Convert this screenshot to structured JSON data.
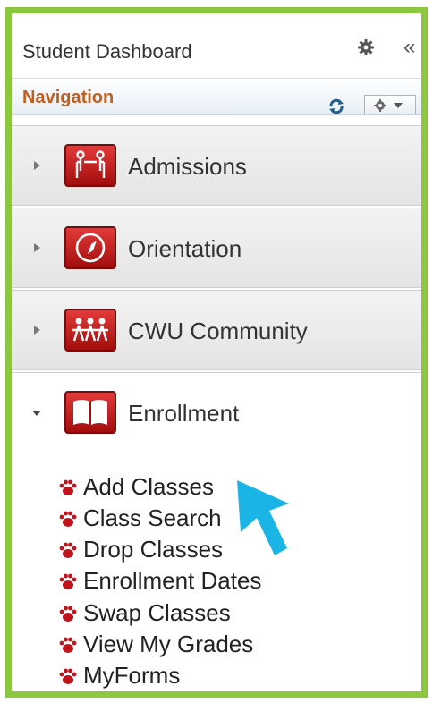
{
  "header": {
    "title": "Student Dashboard",
    "settings_icon": "gear-icon",
    "collapse_label": "«"
  },
  "navbar": {
    "label": "Navigation",
    "refresh_icon": "refresh-icon",
    "options_icon": "gear-dropdown-icon"
  },
  "sections": [
    {
      "label": "Admissions",
      "icon": "people-handshake-icon",
      "expanded": false
    },
    {
      "label": "Orientation",
      "icon": "compass-icon",
      "expanded": false
    },
    {
      "label": "CWU Community",
      "icon": "community-people-icon",
      "expanded": false
    },
    {
      "label": "Enrollment",
      "icon": "open-book-icon",
      "expanded": true
    }
  ],
  "enrollment_links": [
    {
      "label": "Add Classes"
    },
    {
      "label": "Class Search"
    },
    {
      "label": "Drop Classes"
    },
    {
      "label": "Enrollment Dates"
    },
    {
      "label": "Swap Classes"
    },
    {
      "label": "View My Grades"
    },
    {
      "label": "MyForms"
    }
  ],
  "colors": {
    "frame_border": "#8dc63f",
    "nav_label": "#c05f1f",
    "icon_red": "#c0141c",
    "cursor": "#1ab4e6"
  }
}
